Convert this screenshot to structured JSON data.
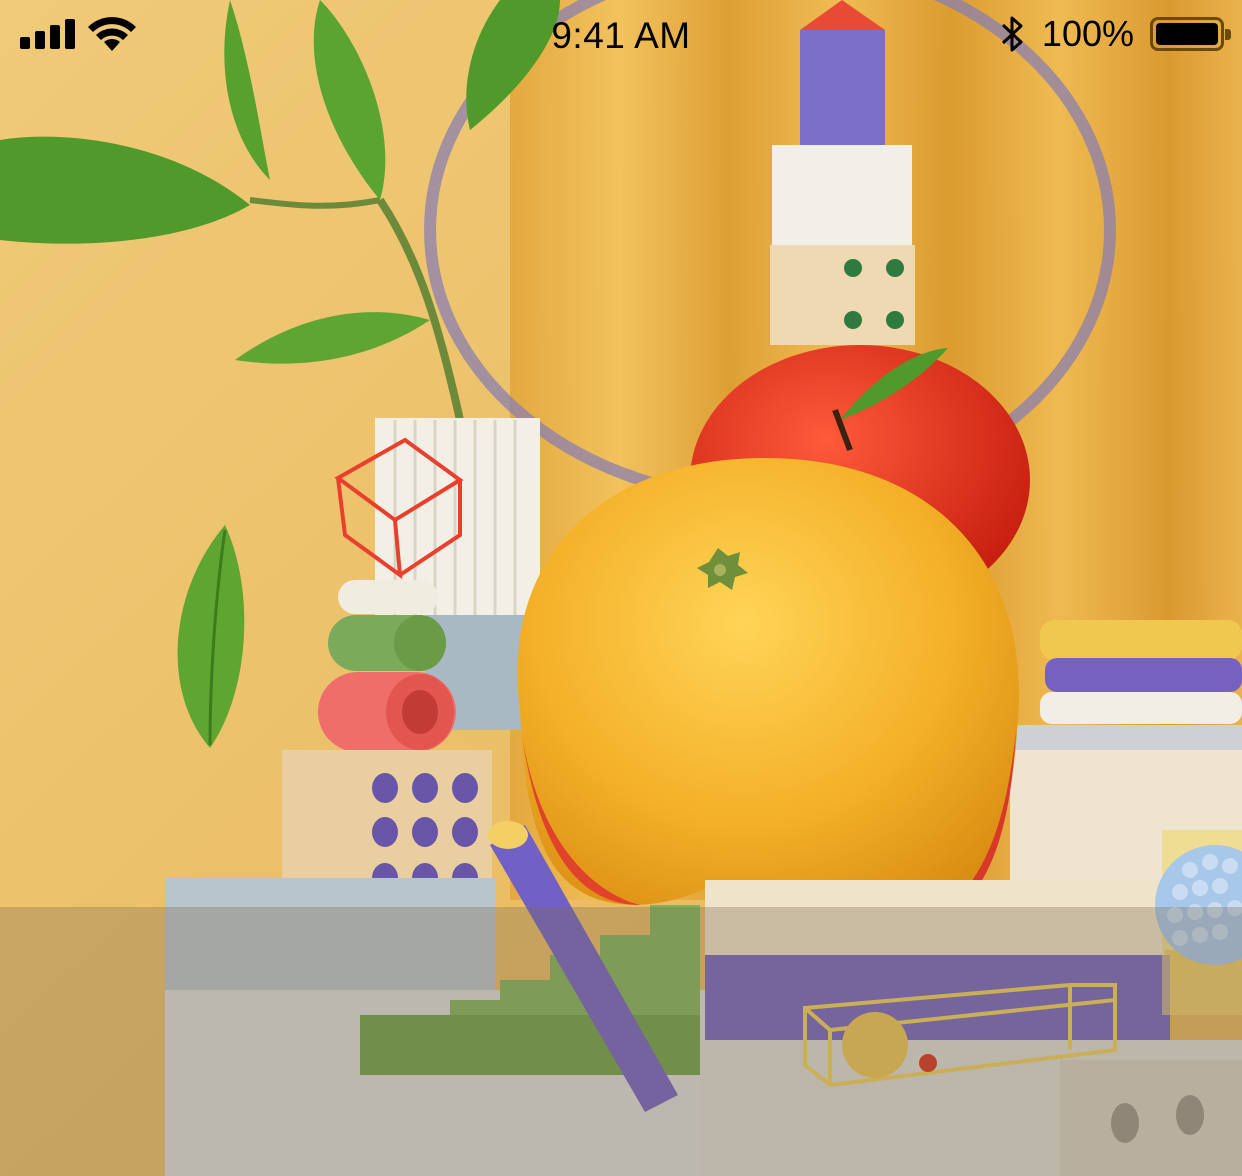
{
  "status_bar": {
    "time": "9:41 AM",
    "battery_percent": "100%",
    "signal_bars": 4,
    "battery_level": 1.0,
    "icons": [
      "cellular-signal-icon",
      "wifi-icon",
      "bluetooth-icon",
      "battery-icon"
    ]
  },
  "wallpaper": {
    "description_icon": "still-life-wallpaper"
  },
  "colors": {
    "background": "#eab653",
    "orange": "#f2b326",
    "apple": "#e8331c",
    "purple": "#6f5fb3",
    "green": "#7aa85a",
    "dock_tint": "#786950"
  }
}
